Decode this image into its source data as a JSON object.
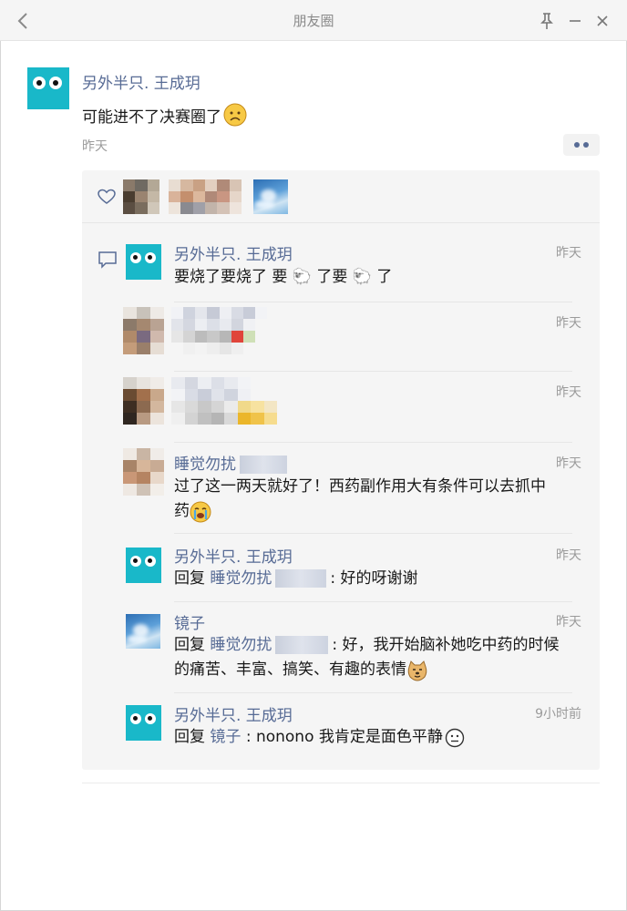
{
  "window": {
    "title": "朋友圈"
  },
  "post": {
    "author": "另外半只. 王成玥",
    "text": "可能进不了决赛圈了",
    "text_emoji": "frown-emoji",
    "time": "昨天"
  },
  "comments": [
    {
      "author": "另外半只. 王成玥",
      "time": "昨天",
      "text": "要烧了要烧了 要 🐑 了要 🐑 了"
    },
    {
      "author": "",
      "time": "昨天",
      "text": ""
    },
    {
      "author": "",
      "time": "昨天",
      "text": ""
    },
    {
      "author": "睡觉勿扰",
      "time": "昨天",
      "text_line1": "过了这一两天就好了！西药副作用大有条件可以去抓中",
      "text_line2": "药",
      "text_emoji": "crying-emoji"
    },
    {
      "author": "另外半只. 王成玥",
      "time": "昨天",
      "reply_prefix": "回复",
      "reply_to": "睡觉勿扰",
      "text": ": 好的呀谢谢"
    },
    {
      "author": "镜子",
      "time": "昨天",
      "reply_prefix": "回复",
      "reply_to": "睡觉勿扰",
      "text_line1": ": 好，我开始脑补她吃中药的时候",
      "text_line2": "的痛苦、丰富、搞笑、有趣的表情",
      "text_emoji": "doge-emoji"
    },
    {
      "author": "另外半只. 王成玥",
      "time": "9小时前",
      "reply_prefix": "回复",
      "reply_to": "镜子",
      "text": ": nonono 我肯定是面色平静",
      "text_emoji": "neutral-face-emoji"
    }
  ],
  "colors": {
    "link": "#576b95",
    "avatar_bg": "#19b8c9",
    "box_bg": "#f5f5f5",
    "time": "#9b9b9b"
  }
}
